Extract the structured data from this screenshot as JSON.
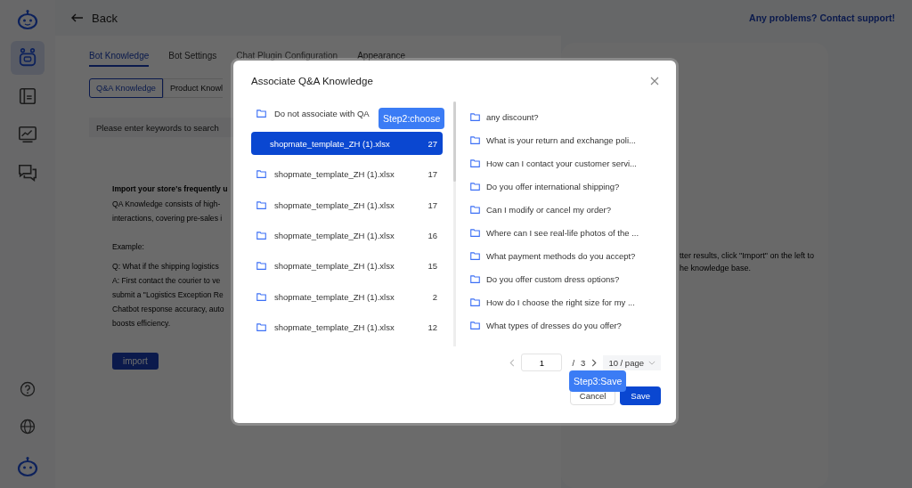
{
  "sidebar": {
    "items": [
      {
        "kind": "robot",
        "selected": true
      },
      {
        "kind": "document",
        "selected": false
      },
      {
        "kind": "chart",
        "selected": false
      },
      {
        "kind": "chat",
        "selected": false
      }
    ],
    "bottom_items": [
      {
        "kind": "help"
      },
      {
        "kind": "globe"
      },
      {
        "kind": "robot"
      }
    ]
  },
  "header": {
    "back": "Back",
    "support_link": "Any problems? Contact support!"
  },
  "tabs": [
    {
      "label": "Bot Knowledge",
      "selected": true,
      "disabled": false
    },
    {
      "label": "Bot Settings",
      "selected": false,
      "disabled": false
    },
    {
      "label": "Chat Plugin Configuration",
      "selected": false,
      "disabled": true
    },
    {
      "label": "Appearance",
      "selected": false,
      "disabled": false
    }
  ],
  "subtabs": [
    {
      "label": "Q&A Knowledge",
      "selected": true
    },
    {
      "label": "Product Knowl",
      "selected": false
    }
  ],
  "search": {
    "placeholder": "Please enter keywords to search"
  },
  "intro": {
    "heading": "Import your store's frequently u",
    "paragraph": [
      "QA Knowledge consists of high-",
      "interactions, covering pre-sales i"
    ],
    "example_label": "Example:",
    "example": [
      "Q: What if the shipping logistics",
      "A: First contact the courier to ve",
      "submit a \"Logistics Exception Re",
      "Chatbot response accuracy, auto",
      "boosts efficiency."
    ],
    "import_button": "import"
  },
  "side_card": {
    "lines": [
      "tter results, click \"Import\" on the left to",
      "he knowledge base."
    ]
  },
  "dialog": {
    "title": "Associate Q&A Knowledge",
    "files": [
      {
        "name": "Do not associate with QA",
        "selected": false
      },
      {
        "name": "shopmate_template_ZH (1).xlsx",
        "count": "27",
        "selected": true
      },
      {
        "name": "shopmate_template_ZH (1).xlsx",
        "count": "17",
        "selected": false
      },
      {
        "name": "shopmate_template_ZH (1).xlsx",
        "count": "17",
        "selected": false
      },
      {
        "name": "shopmate_template_ZH (1).xlsx",
        "count": "16",
        "selected": false
      },
      {
        "name": "shopmate_template_ZH (1).xlsx",
        "count": "15",
        "selected": false
      },
      {
        "name": "shopmate_template_ZH (1).xlsx",
        "count": "2",
        "selected": false
      },
      {
        "name": "shopmate_template_ZH (1).xlsx",
        "count": "12",
        "selected": false
      }
    ],
    "questions": [
      "any discount?",
      "What is your return and exchange poli...",
      "How can I contact your customer servi...",
      "Do you offer international shipping?",
      "Can I modify or cancel my order?",
      "Where can I see real-life photos of the ...",
      "What payment methods do you accept?",
      "Do you offer custom dress options?",
      "How do I choose the right size for my ...",
      "What types of dresses do you offer?"
    ],
    "pagination": {
      "page": "1",
      "separator": "/",
      "total_pages": "3",
      "page_size": "10 / page"
    },
    "cancel": "Cancel",
    "save": "Save"
  },
  "step_hints": [
    "Step2:choose",
    "Step3:Save"
  ]
}
